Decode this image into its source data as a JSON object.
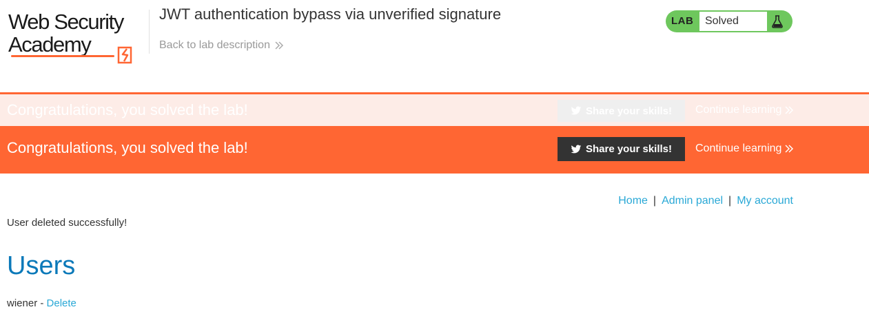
{
  "header": {
    "logo": {
      "line1": "Web Security",
      "line2": "Academy"
    },
    "lab_title": "JWT authentication bypass via unverified signature",
    "back_link": "Back to lab description",
    "lab_status": {
      "tag": "LAB",
      "state": "Solved",
      "icon": "flask-icon",
      "color": "#6ec75d"
    }
  },
  "notification": {
    "message": "Congratulations, you solved the lab!",
    "share_label": "Share your skills!",
    "continue_label": "Continue learning",
    "accent": "#ff6633"
  },
  "nav": {
    "home": "Home",
    "separator": "|",
    "admin_panel": "Admin panel",
    "my_account": "My account"
  },
  "flash_message": "User deleted successfully!",
  "users": {
    "title": "Users",
    "list": [
      {
        "name": "wiener",
        "separator": " - ",
        "action": "Delete"
      }
    ]
  },
  "colors": {
    "link": "#29a8d6",
    "heading": "#0b79b9",
    "brand": "#ff6633"
  }
}
